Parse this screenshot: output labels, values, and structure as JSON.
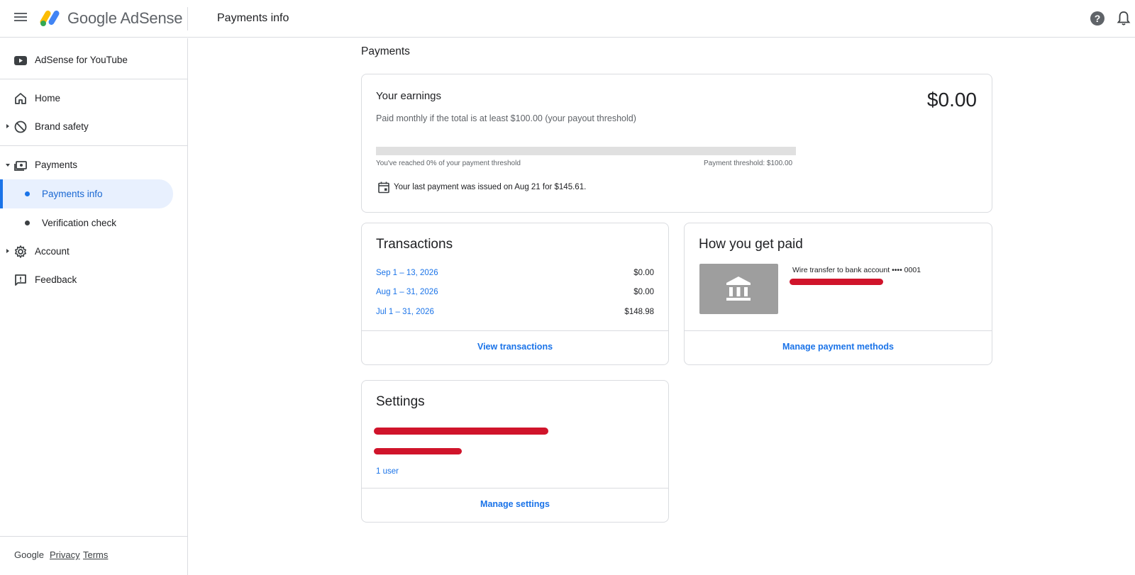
{
  "app": {
    "name": "Google AdSense",
    "page_title": "Payments info"
  },
  "sidebar": {
    "product": "AdSense for YouTube",
    "items": [
      {
        "label": "Home"
      },
      {
        "label": "Brand safety"
      },
      {
        "label": "Payments"
      },
      {
        "label": "Payments info"
      },
      {
        "label": "Verification check"
      },
      {
        "label": "Account"
      },
      {
        "label": "Feedback"
      }
    ],
    "footer": {
      "brand": "Google",
      "privacy": "Privacy",
      "terms": "Terms"
    }
  },
  "main": {
    "section_title": "Payments",
    "earnings": {
      "title": "Your earnings",
      "subtitle": "Paid monthly if the total is at least $100.00 (your payout threshold)",
      "amount": "$0.00",
      "progress_fraction": 0,
      "progress_left": "You've reached 0% of your payment threshold",
      "progress_right": "Payment threshold: $100.00",
      "last_payment": "Your last payment was issued on Aug 21 for $145.61."
    },
    "transactions": {
      "title": "Transactions",
      "rows": [
        {
          "date": "Sep 1 – 13, 2026",
          "amount": "$0.00"
        },
        {
          "date": "Aug 1 – 31, 2026",
          "amount": "$0.00"
        },
        {
          "date": "Jul 1 – 31, 2026",
          "amount": "$148.98"
        }
      ],
      "link": "View transactions"
    },
    "payment_method": {
      "title": "How you get paid",
      "method": "Wire transfer to bank account •••• 0001",
      "link": "Manage payment methods"
    },
    "settings": {
      "title": "Settings",
      "users": "1 user",
      "link": "Manage settings"
    }
  },
  "colors": {
    "accent": "#1a73e8",
    "redaction": "#d0142b"
  }
}
